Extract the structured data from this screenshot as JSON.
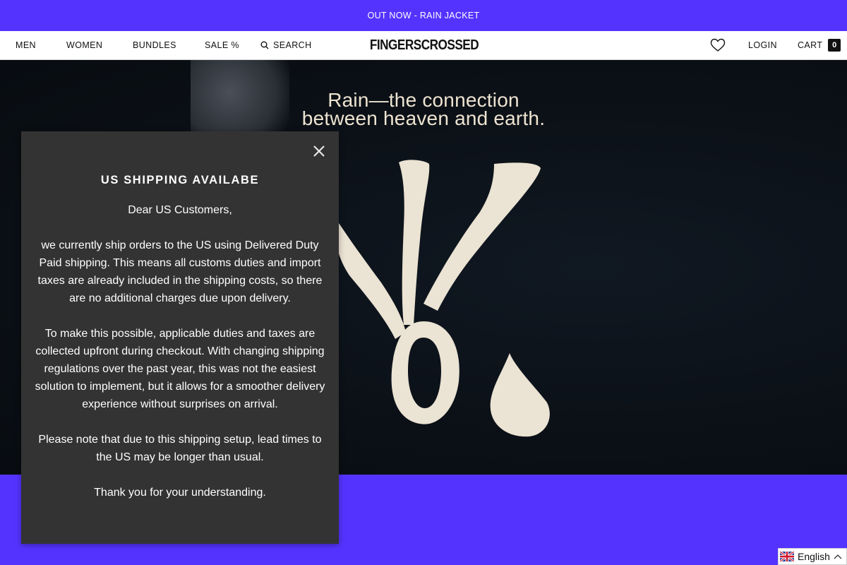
{
  "announcement": {
    "text": "OUT NOW - RAIN JACKET"
  },
  "nav": {
    "men": "MEN",
    "women": "WOMEN",
    "bundles": "BUNDLES",
    "sale": "SALE %",
    "search": "SEARCH",
    "brand": "FINGERSCROSSED",
    "login": "LOGIN",
    "cart": "CART",
    "cart_count": "0"
  },
  "hero": {
    "headline_line1": "Rain—the connection",
    "headline_line2": "between heaven and earth."
  },
  "modal": {
    "title": "US SHIPPING AVAILABE",
    "greeting": "Dear US Customers,",
    "paragraph1": "we currently ship orders to the US using Delivered Duty Paid shipping. This means all customs duties and import taxes are already included in the shipping costs, so there are no additional charges due upon delivery.",
    "paragraph2": "To make this possible, applicable duties and taxes are collected upfront during checkout. With changing shipping regulations over the past year, this was not the easiest solution to implement, but it allows for a smoother delivery experience without surprises on arrival.",
    "paragraph3": "Please note that due to this shipping setup, lead times to the US may be longer than usual.",
    "closing": "Thank you for your understanding."
  },
  "language": {
    "selected": "English"
  },
  "colors": {
    "brand_purple": "#5533ff",
    "modal_bg": "#333333",
    "hero_text": "#ede3d0"
  },
  "icons": {
    "search": "search-icon",
    "wishlist": "heart-icon",
    "close": "close-icon",
    "flag": "uk-flag-icon",
    "chevron": "chevron-up-icon"
  }
}
